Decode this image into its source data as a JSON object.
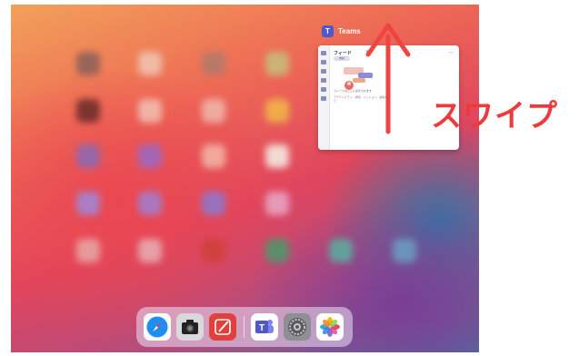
{
  "app_switcher": {
    "app_name": "Teams",
    "teams_glyph": "T",
    "card": {
      "title": "フィード",
      "chevron": "∨",
      "menu": "…",
      "chip_text": "未読",
      "line1": "フィードはここに表示されます",
      "line2": "アクティビティ、通知、メンション、返信など"
    }
  },
  "annotation": {
    "swipe_label": "スワイプ",
    "arrow_color": "#ee4444"
  },
  "dock": {
    "apps": [
      "safari-icon",
      "camera-icon",
      "notes-pen-icon",
      "teams-icon",
      "settings-icon",
      "photos-icon"
    ],
    "teams_glyph": "T"
  }
}
